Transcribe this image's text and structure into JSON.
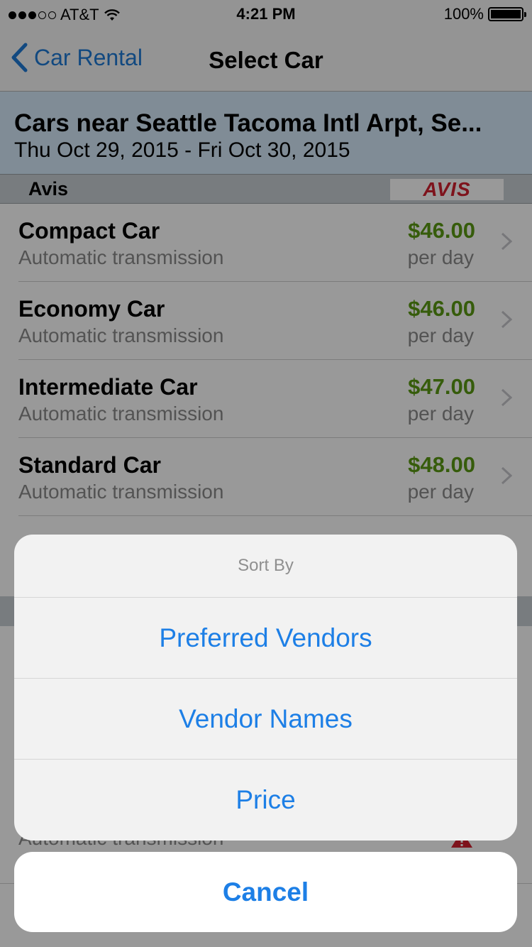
{
  "status_bar": {
    "carrier": "AT&T",
    "time": "4:21 PM",
    "battery": "100%",
    "signal_bars_filled": 3,
    "signal_bars_total": 5
  },
  "nav": {
    "back_label": "Car Rental",
    "title": "Select Car"
  },
  "location": {
    "title": "Cars near Seattle Tacoma Intl Arpt, Se...",
    "dates": "Thu Oct 29, 2015 - Fri Oct 30, 2015"
  },
  "vendor": {
    "name": "Avis",
    "logo_text": "AVIS"
  },
  "cars": [
    {
      "name": "Compact Car",
      "transmission": "Automatic transmission",
      "price": "$46.00",
      "unit": "per day"
    },
    {
      "name": "Economy Car",
      "transmission": "Automatic transmission",
      "price": "$46.00",
      "unit": "per day"
    },
    {
      "name": "Intermediate Car",
      "transmission": "Automatic transmission",
      "price": "$47.00",
      "unit": "per day"
    },
    {
      "name": "Standard Car",
      "transmission": "Automatic transmission",
      "price": "$48.00",
      "unit": "per day"
    }
  ],
  "partial_row": {
    "transmission": "Automatic transmission"
  },
  "action_sheet": {
    "title": "Sort By",
    "options": [
      "Preferred Vendors",
      "Vendor Names",
      "Price"
    ],
    "cancel": "Cancel"
  },
  "colors": {
    "accent": "#1d7fe6",
    "price": "#5a9a13",
    "header_bg": "#d6eafa",
    "avis_red": "#d3202f"
  }
}
